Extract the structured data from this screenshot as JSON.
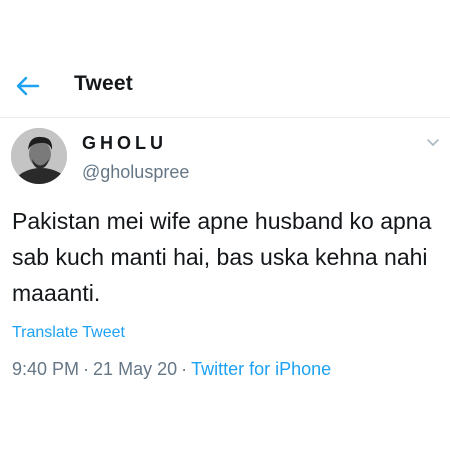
{
  "header": {
    "back_icon": "arrow-left-icon",
    "title": "Tweet"
  },
  "author": {
    "display_name": "GHOLU",
    "handle": "@gholuspree",
    "avatar_icon": "profile-photo"
  },
  "menu_icon": "chevron-down-icon",
  "tweet": {
    "text": "Pakistan mei wife apne husband ko apna sab kuch manti hai, bas uska kehna nahi maaanti.",
    "translate_label": "Translate Tweet",
    "time": "9:40 PM",
    "separator": "·",
    "date": "21 May 20",
    "source": "Twitter for iPhone"
  },
  "colors": {
    "accent": "#1da1f2",
    "text": "#14171a",
    "secondary_text": "#657786",
    "divider": "#e6ecf0"
  }
}
